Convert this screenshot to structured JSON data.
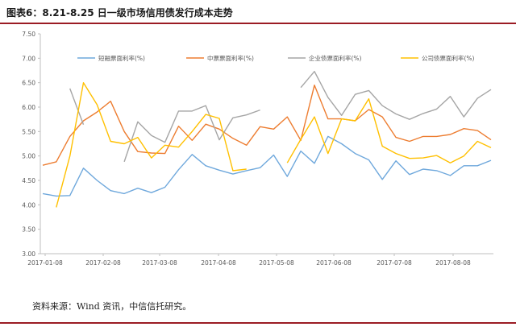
{
  "figure": {
    "title": "图表6：8.21-8.25 日一级市场信用债发行成本走势",
    "source": "资料来源：Wind 资讯，中信信托研究。"
  },
  "chart_data": {
    "type": "line",
    "ylim": [
      3.0,
      7.5
    ],
    "yticks": [
      "7.50",
      "7.00",
      "6.50",
      "6.00",
      "5.50",
      "5.00",
      "4.50",
      "4.00",
      "3.50",
      "3.00"
    ],
    "xlabels": [
      "2017-01-08",
      "2017-02-08",
      "2017-03-08",
      "2017-04-08",
      "2017-05-08",
      "2017-06-08",
      "2017-07-08",
      "2017-08-08"
    ],
    "grid": false,
    "legend_position": "top",
    "series": [
      {
        "name": "短融票面利率(%)",
        "color": "#6fa8dc",
        "values": [
          4.23,
          4.18,
          4.19,
          4.75,
          4.5,
          4.29,
          4.23,
          4.34,
          4.25,
          4.36,
          4.72,
          5.03,
          4.8,
          4.71,
          4.63,
          4.7,
          4.76,
          5.02,
          4.58,
          5.1,
          4.85,
          5.4,
          5.25,
          5.05,
          4.92,
          4.52,
          4.9,
          4.62,
          4.73,
          4.7,
          4.6,
          4.8,
          4.8,
          4.91
        ]
      },
      {
        "name": "中票票面利率(%)",
        "color": "#ed7d31",
        "values": [
          4.81,
          4.88,
          5.4,
          5.72,
          5.9,
          6.12,
          5.5,
          5.09,
          5.06,
          5.05,
          5.61,
          5.32,
          5.65,
          5.55,
          5.36,
          5.22,
          5.6,
          5.55,
          5.8,
          5.32,
          6.45,
          5.76,
          5.76,
          5.72,
          5.95,
          5.8,
          5.38,
          5.3,
          5.4,
          5.4,
          5.44,
          5.56,
          5.52,
          5.33
        ]
      },
      {
        "name": "企业债票面利率(%)",
        "color": "#a5a5a5",
        "values": [
          null,
          null,
          6.38,
          5.64,
          null,
          null,
          4.88,
          5.7,
          5.42,
          5.28,
          5.92,
          5.92,
          6.03,
          5.33,
          5.78,
          5.84,
          5.94,
          null,
          null,
          6.4,
          6.73,
          6.2,
          5.83,
          6.26,
          6.34,
          6.03,
          5.86,
          5.75,
          5.87,
          5.96,
          6.22,
          5.8,
          6.18,
          6.36
        ]
      },
      {
        "name": "公司债票面利率(%)",
        "color": "#ffc000",
        "values": [
          null,
          3.95,
          5.0,
          6.5,
          6.05,
          5.3,
          5.25,
          5.38,
          4.96,
          5.22,
          5.18,
          5.5,
          5.85,
          5.77,
          4.7,
          4.73,
          null,
          null,
          4.86,
          5.34,
          5.8,
          5.05,
          5.76,
          5.72,
          6.17,
          5.2,
          5.05,
          4.95,
          4.96,
          5.01,
          4.86,
          5.0,
          5.3,
          5.17
        ]
      }
    ]
  }
}
